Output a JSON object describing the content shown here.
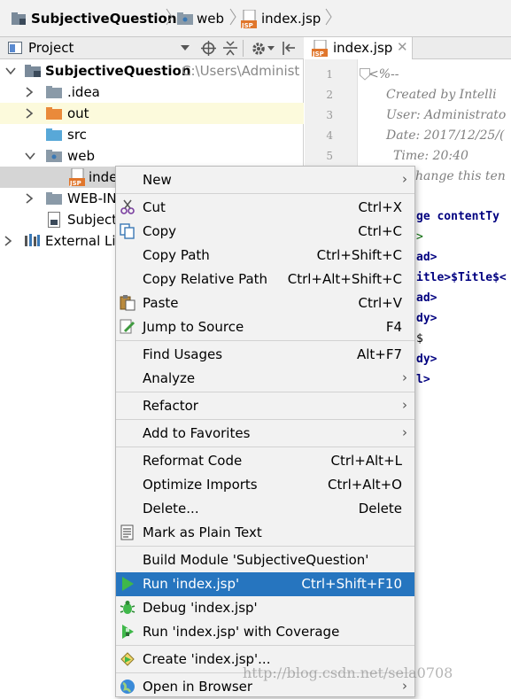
{
  "breadcrumb": {
    "project": "SubjectiveQuestion",
    "folder": "web",
    "file": "index.jsp"
  },
  "project_panel": {
    "title": "Project",
    "tree": [
      {
        "label": "SubjectiveQuestion",
        "path": "C:\\Users\\Administ"
      },
      {
        "label": ".idea"
      },
      {
        "label": "out"
      },
      {
        "label": "src"
      },
      {
        "label": "web"
      },
      {
        "label": "inde"
      },
      {
        "label": "WEB-IN"
      },
      {
        "label": "Subject"
      },
      {
        "label": "External Lib"
      }
    ]
  },
  "editor": {
    "tab_label": "index.jsp",
    "line_numbers": [
      "1",
      "2",
      "3",
      "4",
      "5"
    ],
    "lines": [
      "<%--",
      "Created by Intelli",
      "User: Administrato",
      "Date: 2017/12/25/(",
      "Time: 20:40",
      "hange this ten",
      "ge contentTy",
      ">",
      "ad>",
      "itle>$Title$<",
      "ad>",
      "dy>",
      "$",
      "dy>",
      "l>"
    ]
  },
  "context_menu": {
    "items": [
      {
        "label": "New",
        "shortcut": "",
        "submenu": true
      },
      {
        "label": "Cut",
        "shortcut": "Ctrl+X"
      },
      {
        "label": "Copy",
        "shortcut": "Ctrl+C"
      },
      {
        "label": "Copy Path",
        "shortcut": "Ctrl+Shift+C"
      },
      {
        "label": "Copy Relative Path",
        "shortcut": "Ctrl+Alt+Shift+C"
      },
      {
        "label": "Paste",
        "shortcut": "Ctrl+V"
      },
      {
        "label": "Jump to Source",
        "shortcut": "F4"
      },
      {
        "label": "Find Usages",
        "shortcut": "Alt+F7"
      },
      {
        "label": "Analyze",
        "shortcut": "",
        "submenu": true
      },
      {
        "label": "Refactor",
        "shortcut": "",
        "submenu": true
      },
      {
        "label": "Add to Favorites",
        "shortcut": "",
        "submenu": true
      },
      {
        "label": "Reformat Code",
        "shortcut": "Ctrl+Alt+L"
      },
      {
        "label": "Optimize Imports",
        "shortcut": "Ctrl+Alt+O"
      },
      {
        "label": "Delete...",
        "shortcut": "Delete"
      },
      {
        "label": "Mark as Plain Text",
        "shortcut": ""
      },
      {
        "label": "Build Module 'SubjectiveQuestion'",
        "shortcut": ""
      },
      {
        "label": "Run 'index.jsp'",
        "shortcut": "Ctrl+Shift+F10",
        "selected": true
      },
      {
        "label": "Debug 'index.jsp'",
        "shortcut": ""
      },
      {
        "label": "Run 'index.jsp' with Coverage",
        "shortcut": ""
      },
      {
        "label": "Create 'index.jsp'...",
        "shortcut": ""
      },
      {
        "label": "Open in Browser",
        "shortcut": "",
        "submenu": true
      }
    ]
  },
  "watermark": "http://blog.csdn.net/sela0708",
  "colors": {
    "selection": "#2675bf",
    "highlight_row": "#fcfadc",
    "selected_tree_row": "#d5d5d5"
  }
}
